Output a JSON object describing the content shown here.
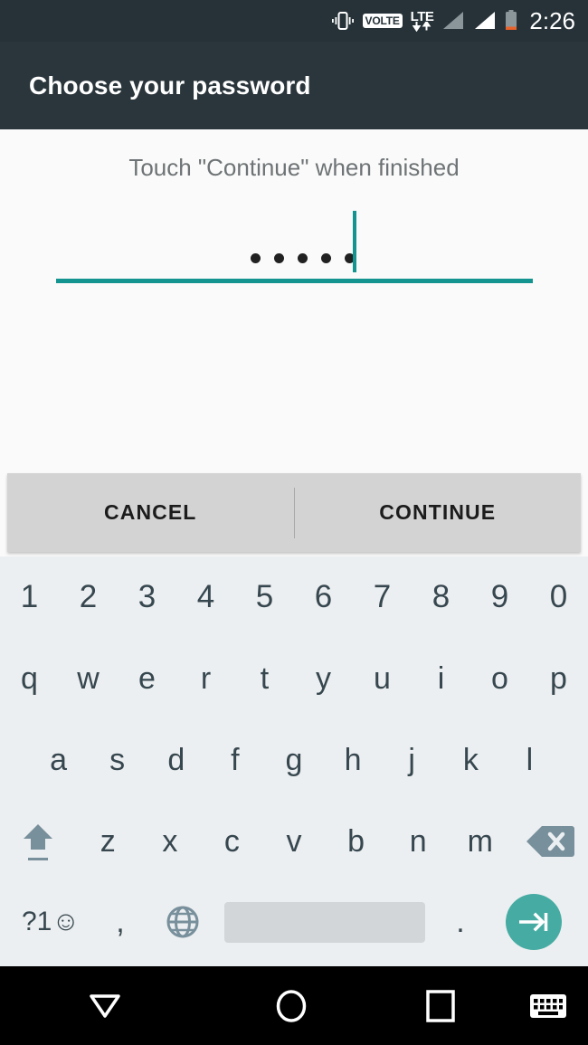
{
  "status_bar": {
    "icons": [
      "vibrate-icon",
      "volte-badge",
      "lte-data-icon",
      "signal-bars-sim1-icon",
      "signal-bars-sim2-icon",
      "battery-icon"
    ],
    "volte_label": "VOLTE",
    "network_label": "LTE",
    "clock": "2:26"
  },
  "header": {
    "title": "Choose your password",
    "background": "#2b363c"
  },
  "content": {
    "instruction": "Touch \"Continue\" when finished",
    "password": {
      "masked_char_count": 5,
      "caret_visible": true,
      "accent_color": "#149490"
    }
  },
  "button_bar": {
    "cancel_label": "CANCEL",
    "continue_label": "CONTINUE",
    "background": "#d3d3d3"
  },
  "keyboard": {
    "background": "#eceff1",
    "digits_row": [
      "1",
      "2",
      "3",
      "4",
      "5",
      "6",
      "7",
      "8",
      "9",
      "0"
    ],
    "letters_row_1": [
      "q",
      "w",
      "e",
      "r",
      "t",
      "y",
      "u",
      "i",
      "o",
      "p"
    ],
    "letters_row_2": [
      "a",
      "s",
      "d",
      "f",
      "g",
      "h",
      "j",
      "k",
      "l"
    ],
    "letters_row_3": [
      "z",
      "x",
      "c",
      "v",
      "b",
      "n",
      "m"
    ],
    "shift_key": "shift-icon",
    "backspace_key": "backspace-icon",
    "bottom_row": {
      "symbols_label": "?1☺",
      "comma_label": ",",
      "globe_key": "globe-icon",
      "space_key": "spacebar",
      "period_label": ".",
      "enter_key": "next-field-icon",
      "enter_color": "#46aca3"
    }
  },
  "nav_bar": {
    "background": "#000000",
    "keys": [
      "back-down-icon",
      "home-icon",
      "recents-icon",
      "keyboard-icon"
    ]
  }
}
